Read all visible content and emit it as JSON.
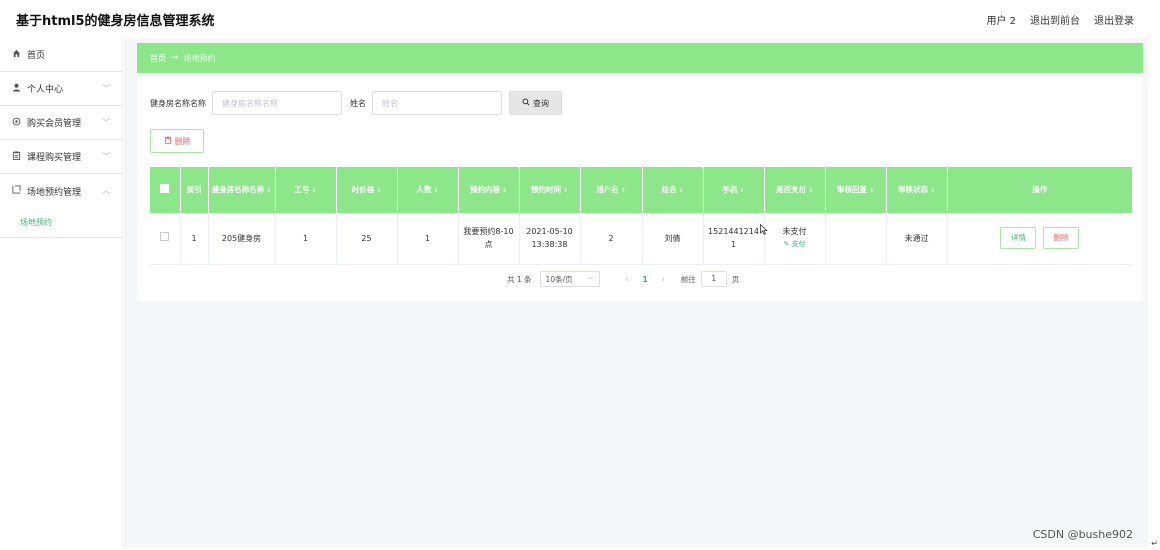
{
  "app": {
    "title": "基于html5的健身房信息管理系统",
    "user": "用户 2",
    "to_front": "退出到前台",
    "logout": "退出登录"
  },
  "sidebar": {
    "items": [
      {
        "label": "首页",
        "icon": "home-icon",
        "has_chevron": false
      },
      {
        "label": "个人中心",
        "icon": "user-icon",
        "has_chevron": true
      },
      {
        "label": "购买会员管理",
        "icon": "gear-icon",
        "has_chevron": true
      },
      {
        "label": "课程购买管理",
        "icon": "clipboard-icon",
        "has_chevron": true
      },
      {
        "label": "场地预约管理",
        "icon": "calendar-icon",
        "has_chevron": true,
        "expanded": true
      }
    ],
    "submenu": [
      {
        "label": "场地预约"
      }
    ]
  },
  "breadcrumb": {
    "home": "首页",
    "current": "场地预约"
  },
  "search": {
    "gym_label": "健身房名称名称",
    "gym_placeholder": "健身房名称名称",
    "name_label": "姓名",
    "name_placeholder": "姓名",
    "query_label": "查询"
  },
  "toolbar": {
    "delete_label": "删除"
  },
  "table": {
    "columns": [
      "索引",
      "健身房名称名称",
      "工号",
      "时价格",
      "人数",
      "预约内容",
      "预约时间",
      "用户名",
      "姓名",
      "手机",
      "是否支付",
      "审核回复",
      "审核状态",
      "操作"
    ],
    "rows": [
      {
        "index": "1",
        "gym_name": "205健身房",
        "job_no": "1",
        "price": "25",
        "people": "1",
        "content": "我要预约8-10点",
        "time": "2021-05-10 13:38:38",
        "username": "2",
        "name": "刘倩",
        "phone": "15214412141",
        "pay_status": "未支付",
        "pay_action": "支付",
        "review_reply": "",
        "review_status": "未通过",
        "detail_label": "详情",
        "delete_label": "删除"
      }
    ]
  },
  "pagination": {
    "total": "共 1 条",
    "page_size": "10条/页",
    "current_page": "1",
    "goto_label": "前往",
    "goto_value": "1",
    "page_unit": "页"
  },
  "watermark": "CSDN @bushe902",
  "colors": {
    "accent": "#8ee68a",
    "link": "#3cb371",
    "danger": "#ee6666"
  }
}
